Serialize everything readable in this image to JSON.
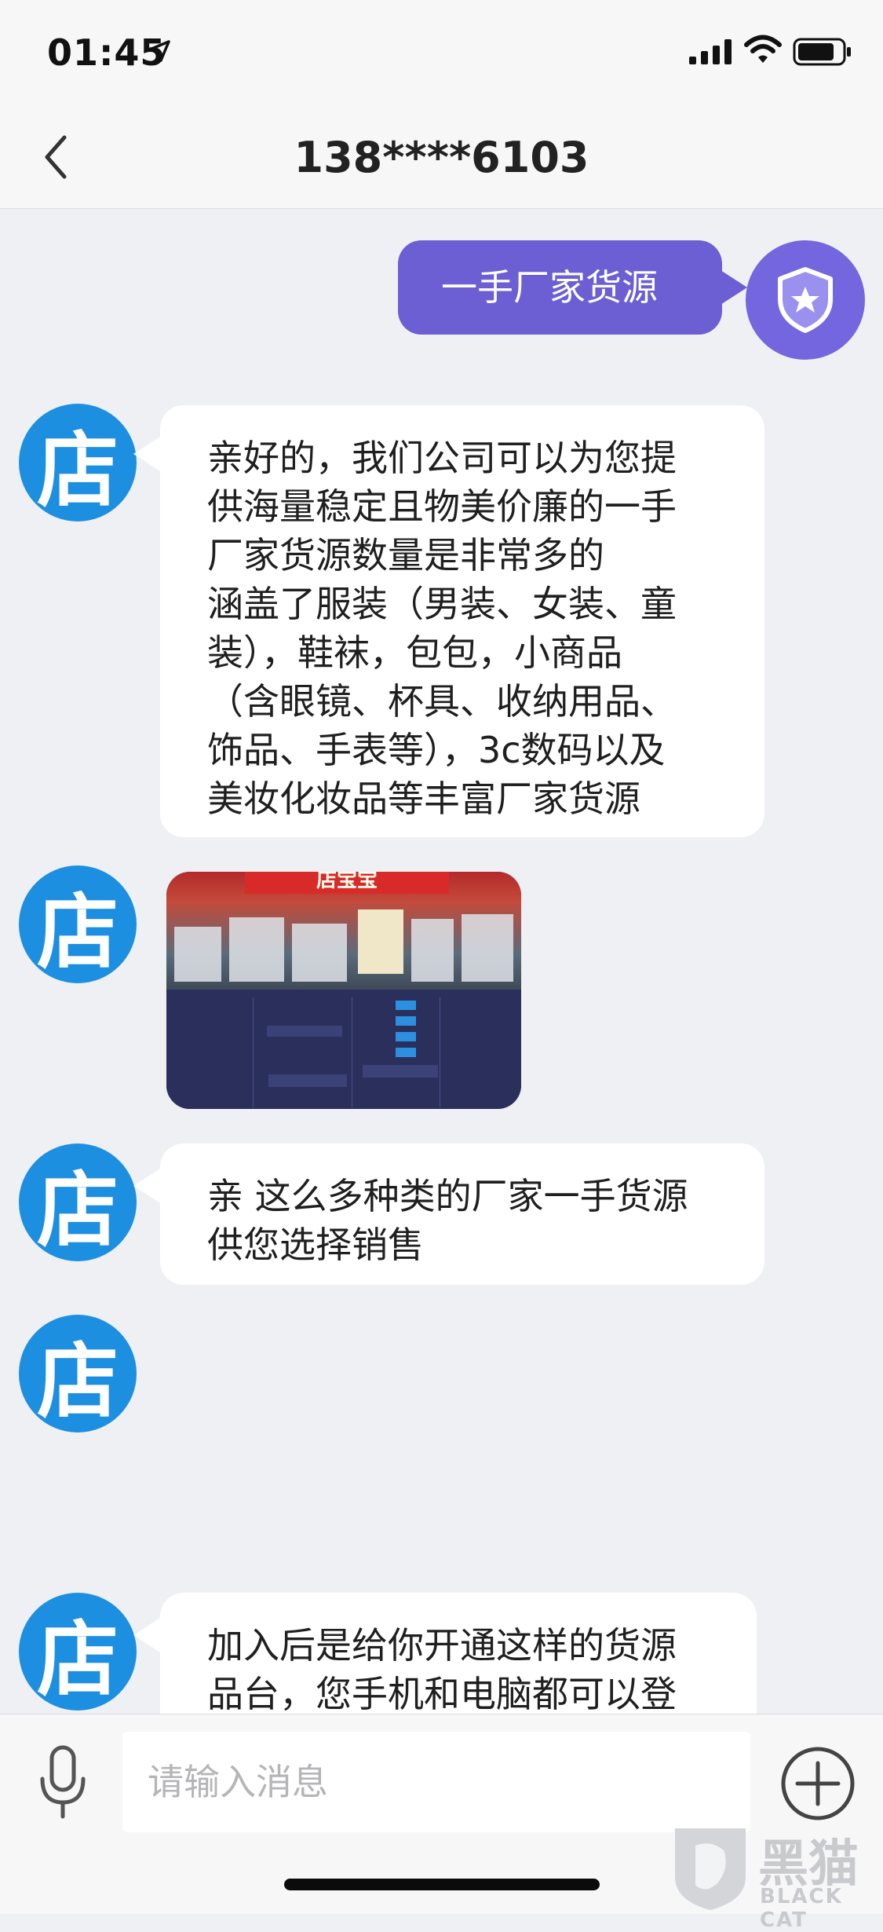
{
  "status_bar": {
    "time": "01:45"
  },
  "header": {
    "title": "138****6103"
  },
  "messages": [
    {
      "from": "me",
      "text": "一手厂家货源"
    },
    {
      "from": "shop",
      "avatar_text": "店",
      "lines": [
        "亲好的，我们公司可以为您提",
        "供海量稳定且物美价廉的一手",
        "厂家货源数量是非常多的",
        "涵盖了服装（男装、女装、童",
        "装），鞋袜，包包，小商品",
        "（含眼镜、杯具、收纳用品、",
        "饰品、手表等），3c数码以及",
        "美妆化妆品等丰富厂家货源"
      ]
    },
    {
      "from": "shop",
      "avatar_text": "店",
      "type": "image",
      "image_banner": "店宝宝"
    },
    {
      "from": "shop",
      "avatar_text": "店",
      "lines": [
        "亲 这么多种类的厂家一手货源",
        "供您选择销售"
      ]
    },
    {
      "from": "shop",
      "avatar_text": "店",
      "type": "empty"
    },
    {
      "from": "shop",
      "avatar_text": "店",
      "lines": [
        "加入后是给你开通这样的货源",
        "品台，您手机和电脑都可以登"
      ]
    }
  ],
  "input_bar": {
    "placeholder": "请输入消息"
  },
  "watermark": {
    "cn": "黑猫",
    "en": "BLACK CAT"
  },
  "colors": {
    "outgoing_bubble": "#6b5fd3",
    "shop_avatar": "#1d8fe0",
    "chat_background": "#eef0f3"
  },
  "icons": {
    "back": "chevron-left-icon",
    "me_avatar": "shield-star-icon",
    "mic": "microphone-icon",
    "plus": "plus-circle-icon"
  }
}
